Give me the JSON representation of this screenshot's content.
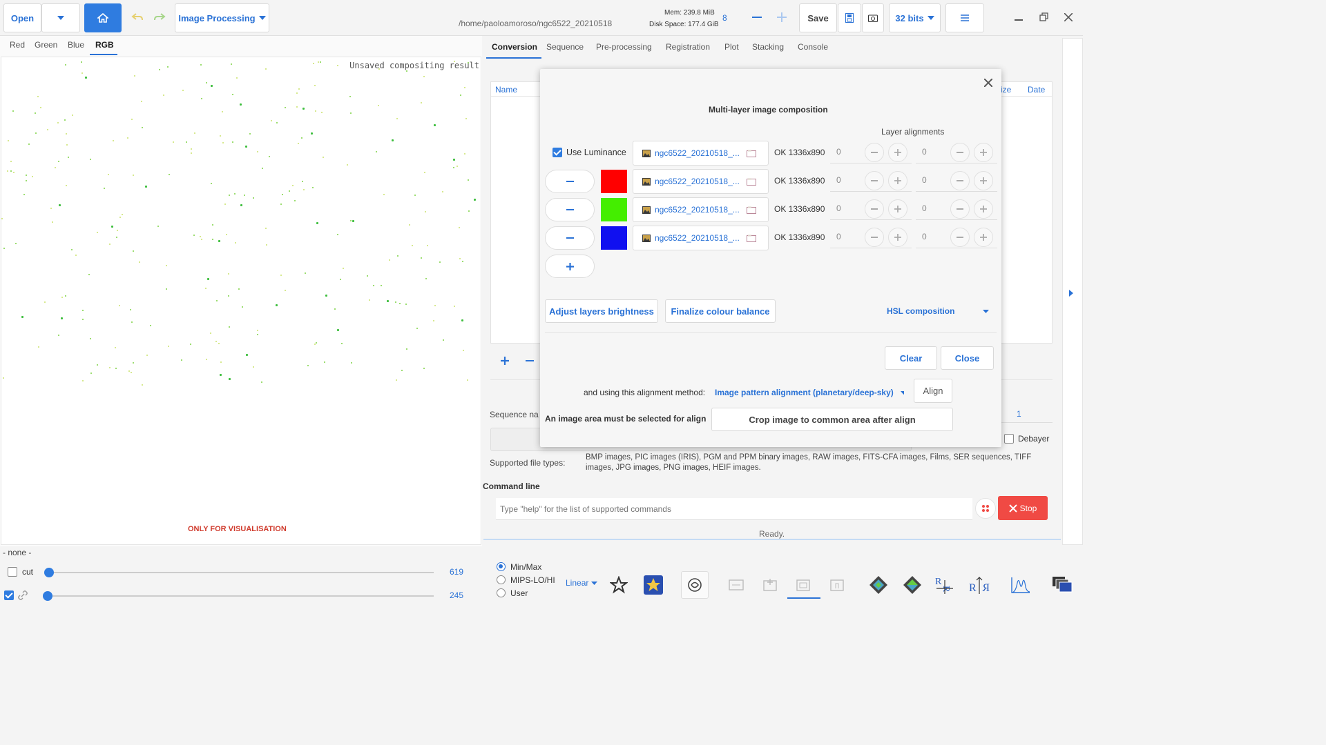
{
  "header": {
    "open_label": "Open",
    "image_processing_label": "Image Processing",
    "path": "/home/paoloamoroso/ngc6522_20210518",
    "mem": "Mem: 239.8 MiB",
    "disk": "Disk Space: 177.4 GiB",
    "threads": "8",
    "save_label": "Save",
    "bits_label": "32 bits"
  },
  "channels": {
    "tabs": [
      "Red",
      "Green",
      "Blue",
      "RGB"
    ],
    "active": "RGB"
  },
  "canvas": {
    "overlay_text": "Unsaved compositing result",
    "footer_warning": "ONLY FOR VISUALISATION"
  },
  "right_tabs": [
    "Conversion",
    "Sequence",
    "Pre-processing",
    "Registration",
    "Plot",
    "Stacking",
    "Console"
  ],
  "file_list": {
    "col_name": "Name",
    "col_size": "ize",
    "col_date": "Date"
  },
  "dialog": {
    "title": "Multi-layer image composition",
    "layer_alignments_label": "Layer alignments",
    "use_luminance_label": "Use Luminance",
    "layers": [
      {
        "file": "ngc6522_20210518_...",
        "status": "OK 1336x890",
        "x": "0",
        "y": "0",
        "color": ""
      },
      {
        "file": "ngc6522_20210518_...",
        "status": "OK 1336x890",
        "x": "0",
        "y": "0",
        "color": "#ff0000"
      },
      {
        "file": "ngc6522_20210518_...",
        "status": "OK 1336x890",
        "x": "0",
        "y": "0",
        "color": "#44ee00"
      },
      {
        "file": "ngc6522_20210518_...",
        "status": "OK 1336x890",
        "x": "0",
        "y": "0",
        "color": "#1010f0"
      }
    ],
    "adjust_brightness_label": "Adjust layers brightness",
    "finalize_balance_label": "Finalize colour balance",
    "hsl_label": "HSL composition",
    "clear_label": "Clear",
    "close_label": "Close",
    "alignment_method_prefix": "and using this alignment method:",
    "alignment_method": "Image pattern alignment (planetary/deep-sky)",
    "align_label": "Align",
    "area_warning": "An image area must be selected for align",
    "crop_label": "Crop image to common area after align"
  },
  "conversion": {
    "sequence_name_label": "Sequence na",
    "seq_start_value": "1",
    "debayer_label": "Debayer",
    "supported_label": "Supported file types:",
    "supported_text_line1": "BMP images, PIC images (IRIS), PGM and PPM binary images, RAW images, FITS-CFA images, Films, SER sequences, TIFF",
    "supported_text_line2": "images, JPG images, PNG images, HEIF images."
  },
  "command_line": {
    "label": "Command line",
    "placeholder": "Type \"help\" for the list of supported commands",
    "stop_label": "Stop",
    "status": "Ready."
  },
  "bottom": {
    "none_label": "- none -",
    "cut_label": "cut",
    "high_value": "619",
    "low_value": "245",
    "radio_options": [
      "Min/Max",
      "MIPS-LO/HI",
      "User"
    ],
    "radio_selected": "Min/Max",
    "scale_mode": "Linear"
  },
  "colors": {
    "accent": "#2a72d6",
    "stop": "#f04a44",
    "warning_text": "#d03a2c"
  }
}
